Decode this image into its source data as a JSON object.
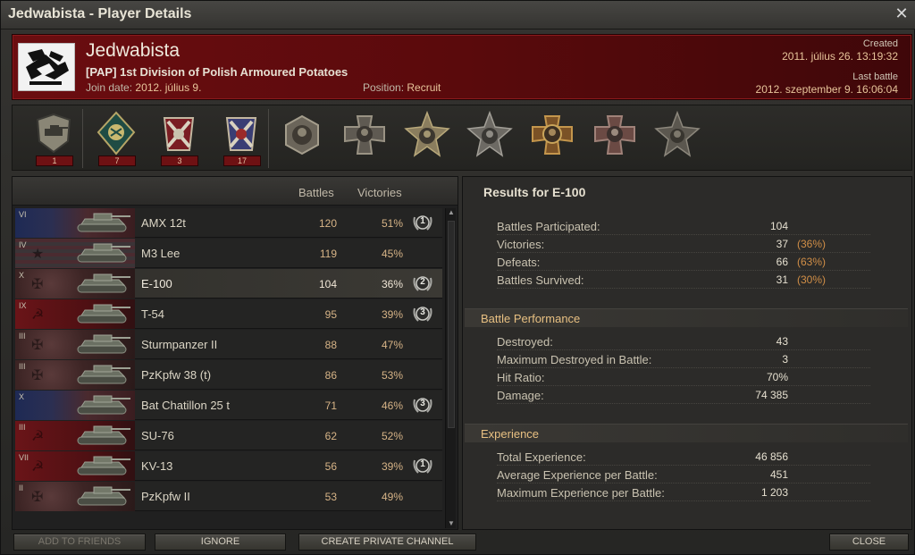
{
  "window": {
    "title": "Jedwabista - Player Details",
    "close_glyph": "✕"
  },
  "player": {
    "name": "Jedwabista",
    "clan_tag": "[PAP]",
    "clan_name": "1st Division of Polish Armoured Potatoes",
    "join_label": "Join date:",
    "join_date": "2012. július 9.",
    "position_label": "Position:",
    "position": "Recruit",
    "created_label": "Created",
    "created": "2011. július 26. 13:19:32",
    "last_battle_label": "Last battle",
    "last_battle": "2012. szeptember 9. 16:06:04"
  },
  "achievements": [
    {
      "icon": "tank-shield-badge-icon",
      "count": "1"
    },
    {
      "icon": "green-diamond-medal-icon",
      "count": "7"
    },
    {
      "icon": "red-crossed-shells-medal-icon",
      "count": "3"
    },
    {
      "icon": "blue-crossed-shells-medal-icon",
      "count": "17"
    },
    {
      "icon": "hexagon-portrait-medal-icon"
    },
    {
      "icon": "iron-cross-portrait-medal-icon"
    },
    {
      "icon": "gold-star-portrait-medal-icon"
    },
    {
      "icon": "silver-star-portrait-medal-icon"
    },
    {
      "icon": "orange-cross-portrait-medal-icon"
    },
    {
      "icon": "red-cross-portrait-medal-icon"
    },
    {
      "icon": "star-portrait-medal-icon"
    }
  ],
  "vehicle_list": {
    "headers": {
      "battles": "Battles",
      "victories": "Victories"
    },
    "rows": [
      {
        "tier": "VI",
        "flag": "france",
        "name": "AMX 12t",
        "battles": "120",
        "victories": "51%",
        "mastery": "1",
        "selected": false
      },
      {
        "tier": "IV",
        "flag": "usa",
        "name": "M3 Lee",
        "battles": "119",
        "victories": "45%",
        "mastery": "",
        "selected": false
      },
      {
        "tier": "X",
        "flag": "germany",
        "name": "E-100",
        "battles": "104",
        "victories": "36%",
        "mastery": "2",
        "selected": true
      },
      {
        "tier": "IX",
        "flag": "ussr",
        "name": "T-54",
        "battles": "95",
        "victories": "39%",
        "mastery": "3",
        "selected": false
      },
      {
        "tier": "III",
        "flag": "germany",
        "name": "Sturmpanzer II",
        "battles": "88",
        "victories": "47%",
        "mastery": "",
        "selected": false
      },
      {
        "tier": "III",
        "flag": "germany",
        "name": "PzKpfw 38 (t)",
        "battles": "86",
        "victories": "53%",
        "mastery": "",
        "selected": false
      },
      {
        "tier": "X",
        "flag": "france",
        "name": "Bat Chatillon 25 t",
        "battles": "71",
        "victories": "46%",
        "mastery": "3",
        "selected": false
      },
      {
        "tier": "III",
        "flag": "ussr",
        "name": "SU-76",
        "battles": "62",
        "victories": "52%",
        "mastery": "",
        "selected": false
      },
      {
        "tier": "VII",
        "flag": "ussr",
        "name": "KV-13",
        "battles": "56",
        "victories": "39%",
        "mastery": "1",
        "selected": false
      },
      {
        "tier": "II",
        "flag": "germany",
        "name": "PzKpfw II",
        "battles": "53",
        "victories": "49%",
        "mastery": "",
        "selected": false
      }
    ]
  },
  "results": {
    "title": "Results for E-100",
    "general": [
      {
        "label": "Battles Participated:",
        "value": "104",
        "pct": ""
      },
      {
        "label": "Victories:",
        "value": "37",
        "pct": "(36%)"
      },
      {
        "label": "Defeats:",
        "value": "66",
        "pct": "(63%)"
      },
      {
        "label": "Battles Survived:",
        "value": "31",
        "pct": "(30%)"
      }
    ],
    "performance_title": "Battle Performance",
    "performance": [
      {
        "label": "Destroyed:",
        "value": "43"
      },
      {
        "label": "Maximum Destroyed in Battle:",
        "value": "3"
      },
      {
        "label": "Hit Ratio:",
        "value": "70%"
      },
      {
        "label": "Damage:",
        "value": "74 385"
      }
    ],
    "experience_title": "Experience",
    "experience": [
      {
        "label": "Total Experience:",
        "value": "46 856"
      },
      {
        "label": "Average Experience per Battle:",
        "value": "451"
      },
      {
        "label": "Maximum Experience per Battle:",
        "value": "1 203"
      }
    ]
  },
  "buttons": {
    "add_friends": "ADD TO FRIENDS",
    "ignore": "IGNORE",
    "private_channel": "CREATE PRIVATE CHANNEL",
    "close": "CLOSE"
  }
}
